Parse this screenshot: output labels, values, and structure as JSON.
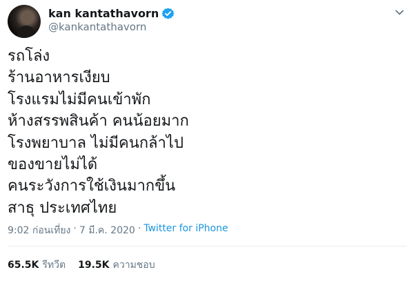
{
  "user": {
    "display_name": "kan kantathavorn",
    "handle": "@kankantathavorn",
    "verified": true
  },
  "tweet": {
    "lines": [
      "รถโล่ง",
      "ร้านอาหารเงียบ",
      "โรงแรมไม่มีคนเข้าพัก",
      "ห้างสรรพสินค้า คนน้อยมาก",
      "โรงพยาบาล ไม่มีคนกล้าไป",
      "ของขายไม่ได้",
      "คนระวังการใช้เงินมากขึ้น",
      "สาธุ ประเทศไทย"
    ],
    "time": "9:02 ก่อนเที่ยง",
    "date": "7 มี.ค. 2020",
    "source": "Twitter for iPhone",
    "separator": "·"
  },
  "stats": {
    "retweets_count": "65.5K",
    "retweets_label": "รีทวีต",
    "likes_count": "19.5K",
    "likes_label": "ความชอบ"
  },
  "icons": {
    "verified": "verified-badge-icon",
    "more": "chevron-down-icon"
  },
  "colors": {
    "accent": "#1da1f2",
    "link": "#1b95e0",
    "secondary_text": "#657786",
    "divider": "#e6ecf0"
  }
}
